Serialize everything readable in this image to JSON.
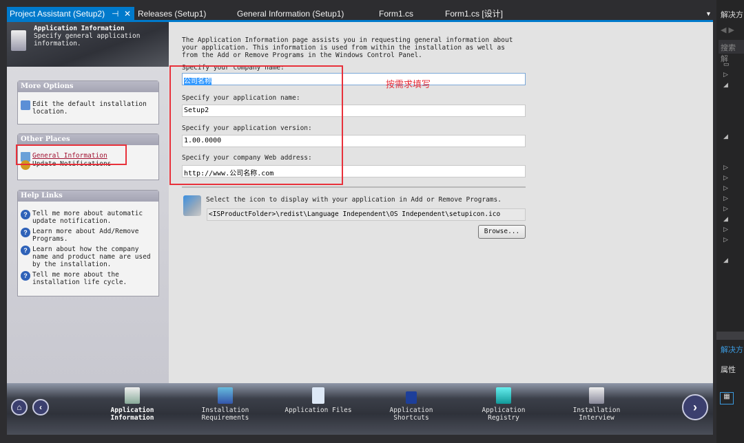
{
  "tabs": [
    {
      "label": "Project Assistant (Setup2)",
      "active": true
    },
    {
      "label": "Releases (Setup1)"
    },
    {
      "label": "General Information (Setup1)"
    },
    {
      "label": "Form1.cs"
    },
    {
      "label": "Form1.cs [设计]"
    }
  ],
  "header": {
    "title": "Application Information",
    "subtitle": "Specify general application information."
  },
  "more_options": {
    "title": "More Options",
    "items": [
      "Edit the default installation location."
    ]
  },
  "other_places": {
    "title": "Other Places",
    "items": [
      "General Information",
      "Update Notifications"
    ]
  },
  "help_links": {
    "title": "Help Links",
    "items": [
      "Tell me more about automatic update notification.",
      "Learn more about Add/Remove Programs.",
      "Learn about how the company name and product name are used by the installation.",
      "Tell me more about the installation life cycle."
    ]
  },
  "intro": "The Application Information page assists you in requesting general information about your application. This information is used from within the installation as well as from the Add or Remove Programs in the Windows Control Panel.",
  "fields": [
    {
      "label": "Specify your company name:",
      "value": "公司名称"
    },
    {
      "label": "Specify your application name:",
      "value": "Setup2"
    },
    {
      "label": "Specify your application version:",
      "value": "1.00.0000"
    },
    {
      "label": "Specify your company Web address:",
      "value": "http://www.公司名称.com"
    }
  ],
  "annotation": "按需求填写",
  "icon_section": {
    "label": "Select the icon to display with your application in Add or Remove Programs.",
    "path": "<ISProductFolder>\\redist\\Language Independent\\OS Independent\\setupicon.ico",
    "browse": "Browse..."
  },
  "nav": [
    {
      "label": "Application Information",
      "active": true
    },
    {
      "label": "Installation Requirements"
    },
    {
      "label": "Application Files"
    },
    {
      "label": "Application Shortcuts"
    },
    {
      "label": "Application Registry"
    },
    {
      "label": "Installation Interview"
    }
  ],
  "side": {
    "title": "解决方",
    "search": "搜索解",
    "footer": "解决方",
    "props": "属性"
  }
}
